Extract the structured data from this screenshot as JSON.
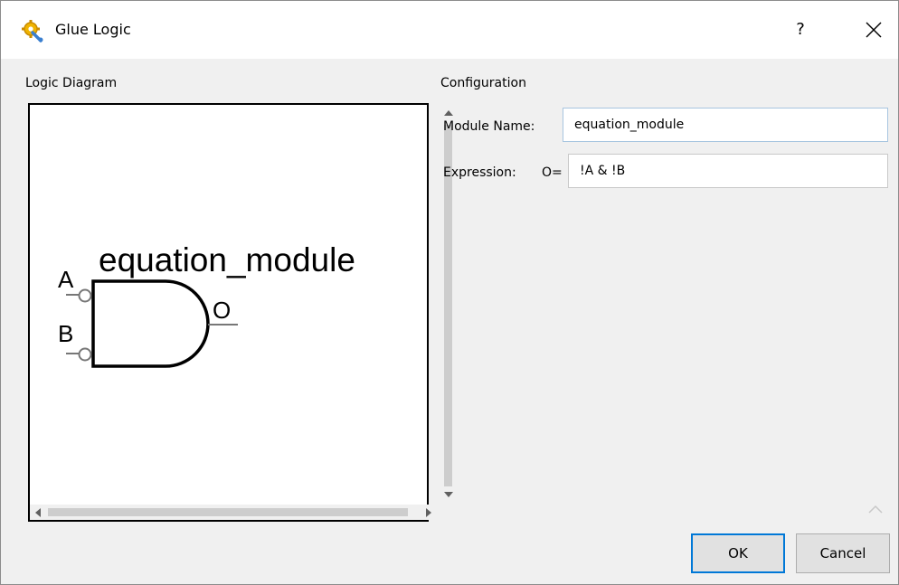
{
  "window": {
    "title": "Glue Logic",
    "help_label": "?",
    "icons": {
      "app": "gear-wrench-icon",
      "close": "close-icon"
    }
  },
  "logic_diagram": {
    "label": "Logic Diagram",
    "module_label": "equation_module",
    "input_a": "A",
    "input_b": "B",
    "output": "O"
  },
  "configuration": {
    "label": "Configuration",
    "module_name_label": "Module Name:",
    "module_name_value": "equation_module",
    "expression_label": "Expression:",
    "expression_prefix": "O=",
    "expression_value": "!A & !B"
  },
  "buttons": {
    "ok": "OK",
    "cancel": "Cancel"
  }
}
